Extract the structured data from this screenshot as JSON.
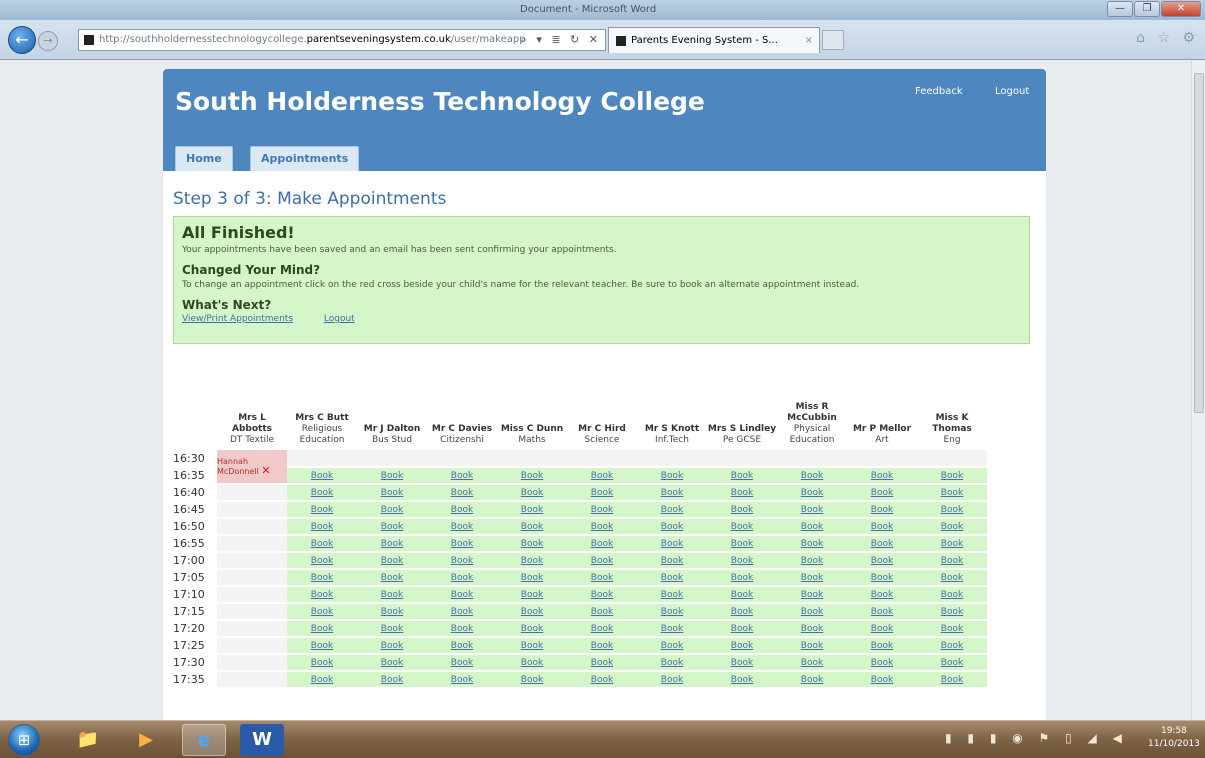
{
  "browser": {
    "window_title": "Document - Microsoft Word",
    "url_prefix": "http://southholdernesstechnologycollege.",
    "url_host": "parentseveningsystem.co.uk",
    "url_suffix": "/user/makeapp",
    "tab_title": "Parents Evening System - S...",
    "nav_back": "←",
    "nav_forward": "→",
    "address_tools": "⌕ ▾ ≣ ↻ ✕",
    "tab_close": "×",
    "right_icons": "⌂ ☆ ⚙",
    "window_buttons": {
      "min": "—",
      "max": "❐",
      "close": "✕"
    }
  },
  "site": {
    "title": "South Holderness Technology College",
    "feedback": "Feedback",
    "logout": "Logout",
    "tabs": [
      "Home",
      "Appointments"
    ]
  },
  "main": {
    "step_title": "Step 3 of 3: Make Appointments",
    "finished_heading": "All Finished!",
    "finished_text": "Your appointments have been saved and an email has been sent confirming your appointments.",
    "changed_heading": "Changed Your Mind?",
    "changed_text": "To change an appointment click on the red cross beside your child's name for the relevant teacher. Be sure to book an alternate appointment instead.",
    "next_heading": "What's Next?",
    "view_print": "View/Print Appointments",
    "logout_link": "Logout"
  },
  "table": {
    "teachers": [
      {
        "name": "Mrs L Abbotts",
        "subject": "DT Textile"
      },
      {
        "name": "Mrs C Butt",
        "subject": "Religious Education"
      },
      {
        "name": "Mr J Dalton",
        "subject": "Bus Stud"
      },
      {
        "name": "Mr C Davies",
        "subject": "Citizenshi"
      },
      {
        "name": "Miss C Dunn",
        "subject": "Maths"
      },
      {
        "name": "Mr C Hird",
        "subject": "Science"
      },
      {
        "name": "Mr S Knott",
        "subject": "Inf.Tech"
      },
      {
        "name": "Mrs S Lindley",
        "subject": "Pe GCSE"
      },
      {
        "name": "Miss R McCubbin",
        "subject": "Physical Education"
      },
      {
        "name": "Mr P Mellor",
        "subject": "Art"
      },
      {
        "name": "Miss K Thomas",
        "subject": "Eng"
      }
    ],
    "times": [
      "16:30",
      "16:35",
      "16:40",
      "16:45",
      "16:50",
      "16:55",
      "17:00",
      "17:05",
      "17:10",
      "17:15",
      "17:20",
      "17:25",
      "17:30",
      "17:35"
    ],
    "book_label": "Book",
    "booked_student": "Hannah McDonnell",
    "cancel_icon": "✕"
  },
  "taskbar": {
    "start": "⊞",
    "apps": [
      {
        "name": "explorer",
        "icon": "📁"
      },
      {
        "name": "media-player",
        "icon": "▶"
      },
      {
        "name": "internet-explorer",
        "icon": "e"
      },
      {
        "name": "word",
        "icon": "W"
      }
    ],
    "tray_icons": "▮ ▮ ▮ ◉ ⚑ ▯ ◢ ◀",
    "time": "19:58",
    "date": "11/10/2013"
  },
  "colors": {
    "header_blue": "#4e86bf",
    "success_green": "#d4f6c8",
    "booked_red": "#f2c9c9",
    "link_blue": "#4672a8"
  }
}
